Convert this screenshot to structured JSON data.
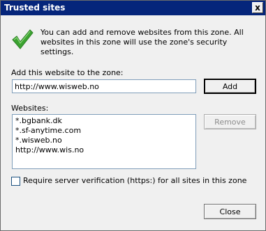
{
  "window": {
    "title": "Trusted sites",
    "close_glyph": "x"
  },
  "intro_text": "You can add and remove websites from this zone. All websites in this zone will use the zone's security settings.",
  "add_section": {
    "label": "Add this website to the zone:",
    "input_value": "http://www.wisweb.no",
    "add_label": "Add"
  },
  "websites": {
    "label": "Websites:",
    "items": [
      "*.bgbank.dk",
      "*.sf-anytime.com",
      "*.wisweb.no",
      "http://www.wis.no"
    ],
    "remove_label": "Remove"
  },
  "https_checkbox": {
    "label": "Require server verification (https:) for all sites in this zone",
    "checked": false
  },
  "close_label": "Close",
  "icons": {
    "checkmark": "check-icon",
    "checkmark_color": "#3ca331"
  }
}
